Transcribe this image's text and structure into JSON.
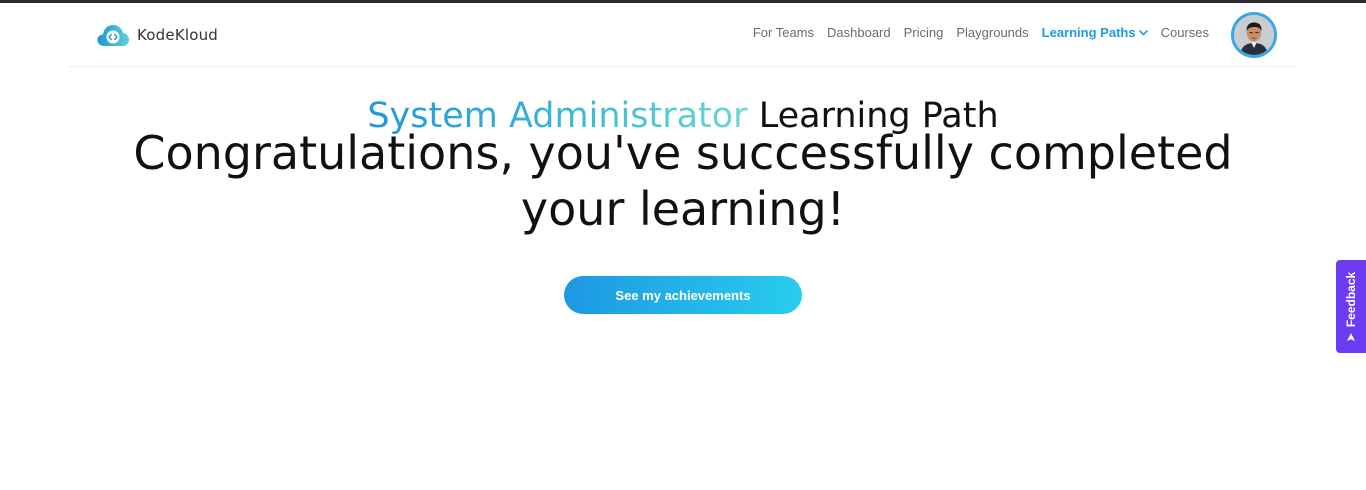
{
  "header": {
    "brand": "KodeKloud",
    "nav": [
      {
        "label": "For Teams"
      },
      {
        "label": "Dashboard"
      },
      {
        "label": "Pricing"
      },
      {
        "label": "Playgrounds"
      },
      {
        "label": "Learning Paths",
        "active": true,
        "icon": "chevron-down-icon"
      },
      {
        "label": "Courses"
      }
    ],
    "avatar_icon": "user-avatar"
  },
  "hero": {
    "path_name": "System Administrator",
    "path_suffix": "Learning Path",
    "message": "Congratulations, you've successfully completed your learning!",
    "cta_label": "See my achievements"
  },
  "feedback": {
    "label": "Feedback",
    "icon": "send-arrow-icon"
  },
  "colors": {
    "accent": "#1c9be6",
    "button_start": "#1e98e3",
    "button_end": "#28cdee",
    "feedback_bg": "#6b3cf2"
  }
}
